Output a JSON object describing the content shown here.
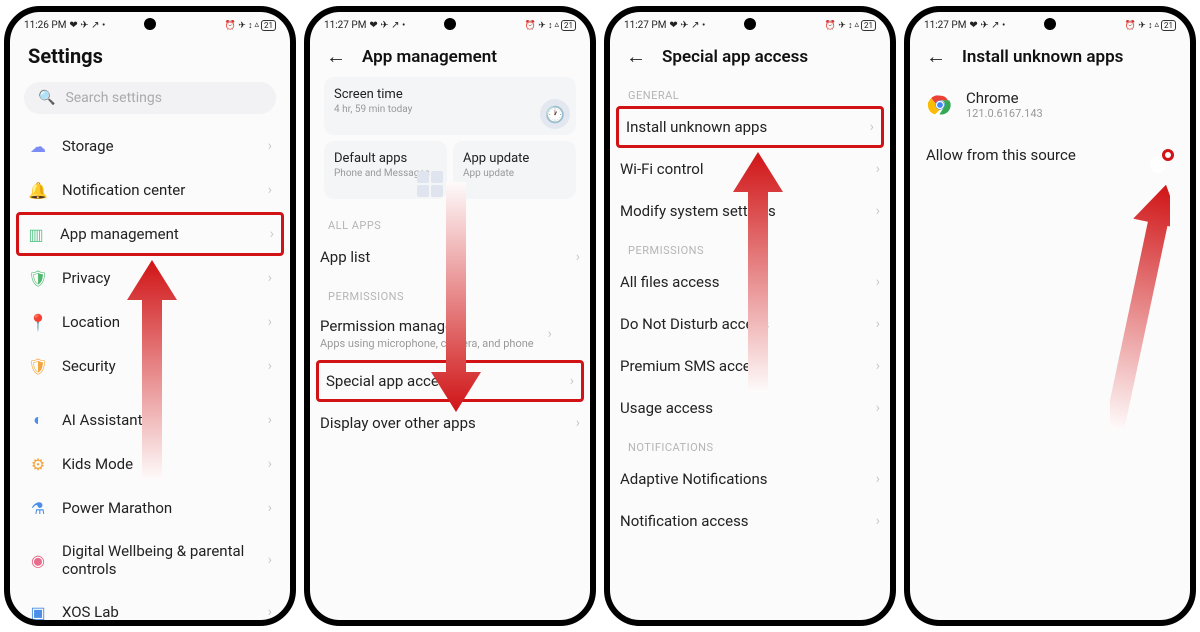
{
  "status": {
    "time1": "11:26 PM",
    "time2": "11:27 PM",
    "battery": "21",
    "iconsLeft": "❤ ✈ ↗ •",
    "iconsRight": "⏰ ✈ ↕"
  },
  "screen1": {
    "title": "Settings",
    "searchPlaceholder": "Search settings",
    "items": [
      {
        "icon": "☁",
        "cls": "ic-storage",
        "label": "Storage"
      },
      {
        "icon": "🔔",
        "cls": "ic-notif",
        "label": "Notification center"
      },
      {
        "icon": "▥",
        "cls": "ic-app",
        "label": "App management",
        "hl": true
      },
      {
        "icon": "🛡",
        "cls": "ic-priv",
        "label": "Privacy"
      },
      {
        "icon": "📍",
        "cls": "ic-loc",
        "label": "Location"
      },
      {
        "icon": "🛡",
        "cls": "ic-sec",
        "label": "Security"
      }
    ],
    "items2": [
      {
        "icon": "◐",
        "cls": "ic-ai",
        "label": "AI Assistant"
      },
      {
        "icon": "⚙",
        "cls": "ic-kids",
        "label": "Kids Mode"
      },
      {
        "icon": "⚗",
        "cls": "ic-power",
        "label": "Power Marathon"
      },
      {
        "icon": "◉",
        "cls": "ic-well",
        "label": "Digital Wellbeing & parental controls"
      },
      {
        "icon": "▣",
        "cls": "ic-xos",
        "label": "XOS Lab"
      }
    ]
  },
  "screen2": {
    "title": "App management",
    "screenTime": {
      "title": "Screen time",
      "sub": "4 hr, 59 min today"
    },
    "defaultApps": {
      "title": "Default apps",
      "sub": "Phone and Messages"
    },
    "appUpdate": {
      "title": "App update",
      "sub": "App update"
    },
    "sectAllApps": "ALL APPS",
    "appList": "App list",
    "sectPerms": "PERMISSIONS",
    "permMgr": {
      "title": "Permission manager",
      "sub": "Apps using microphone, camera, and phone"
    },
    "specialAccess": "Special app access",
    "displayOver": "Display over other apps"
  },
  "screen3": {
    "title": "Special app access",
    "sectGeneral": "GENERAL",
    "items1": [
      {
        "label": "Install unknown apps",
        "hl": true
      },
      {
        "label": "Wi-Fi control"
      },
      {
        "label": "Modify system settings"
      }
    ],
    "sectPerms": "PERMISSIONS",
    "items2": [
      {
        "label": "All files access"
      },
      {
        "label": "Do Not Disturb access"
      },
      {
        "label": "Premium SMS access"
      },
      {
        "label": "Usage access"
      }
    ],
    "sectNotif": "NOTIFICATIONS",
    "items3": [
      {
        "label": "Adaptive Notifications"
      },
      {
        "label": "Notification access"
      }
    ]
  },
  "screen4": {
    "title": "Install unknown apps",
    "app": {
      "name": "Chrome",
      "version": "121.0.6167.143"
    },
    "allowLabel": "Allow from this source",
    "toggleOn": true
  }
}
